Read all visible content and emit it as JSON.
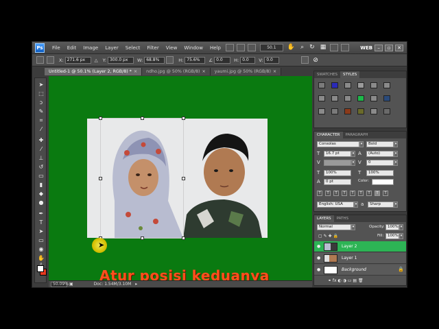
{
  "menubar": {
    "logo": "Ps",
    "items": [
      "File",
      "Edit",
      "Image",
      "Layer",
      "Select",
      "Filter",
      "View",
      "Window",
      "Help"
    ],
    "zoom": "50.1",
    "workspace": "WEB",
    "icons": [
      "bridge-icon",
      "mini-bridge-icon",
      "hand-icon",
      "zoom-icon",
      "rotate-icon",
      "arrange-icon",
      "screen-mode-icon"
    ]
  },
  "options": {
    "x_label": "X:",
    "x_value": "271.6 px",
    "y_label": "Y:",
    "y_value": "300.0 px",
    "w_label": "W:",
    "w_value": "68.8%",
    "h_label": "H:",
    "h_value": "75.6%",
    "angle_value": "0.0",
    "hskew_label": "H:",
    "hskew_value": "0.0",
    "vskew_label": "V:",
    "vskew_value": "0.0"
  },
  "tabs": [
    {
      "label": "Untitled-1 @ 50.1% (Layer 2, RGB/8) *",
      "active": true
    },
    {
      "label": "ndho.jpg @ 50% (RGB/8)",
      "active": false
    },
    {
      "label": "yaumi.jpg @ 50% (RGB/8)",
      "active": false
    }
  ],
  "canvas": {
    "background_color": "#0a7a10",
    "caption": "Atur posisi keduanya"
  },
  "status": {
    "zoom": "50.09%",
    "doc": "Doc: 1.54M/3.10M"
  },
  "panels": {
    "swatches_tabs": [
      "SWATCHES",
      "STYLES"
    ],
    "swatch_colors": [
      "#7b7b7b",
      "#2a2ab8",
      "#8a8a8a",
      "#9a9a9a",
      "#8a8a8a",
      "#8a8a8a",
      "#8a8a8a",
      "#8a8a8a",
      "#8a8a8a",
      "#1db84a",
      "#8a8a8a",
      "#2a4a7a",
      "#8a8a8a",
      "#7a7a7a",
      "#8a3a1a",
      "#6a6a2a",
      "#8a8a8a",
      "#6a6a6a"
    ],
    "character_tabs": [
      "CHARACTER",
      "PARAGRAPH"
    ],
    "character": {
      "font": "Consolas",
      "style": "Bold",
      "size": "16.7 pt",
      "leading": "(Auto)",
      "tracking": "0",
      "vscale": "100%",
      "hscale": "100%",
      "baseline": "0 pt",
      "color_label": "Color:",
      "language": "English: USA",
      "antialias": "Sharp",
      "aa_label": "a"
    },
    "layers_tabs": [
      "LAYERS",
      "PATHS"
    ],
    "layers": {
      "blend_mode": "Normal",
      "opacity_label": "Opacity:",
      "opacity": "100%",
      "fill_label": "Fill:",
      "fill": "100%",
      "items": [
        {
          "name": "Layer 2",
          "selected": true
        },
        {
          "name": "Layer 1",
          "selected": false
        },
        {
          "name": "Background",
          "selected": false
        }
      ]
    }
  }
}
